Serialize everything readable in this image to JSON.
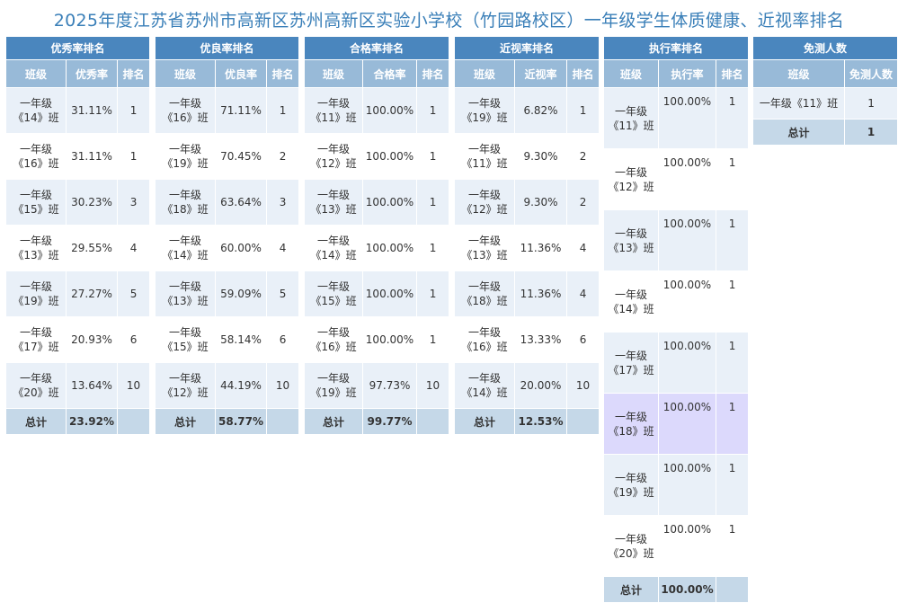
{
  "title": "2025年度江苏省苏州市高新区苏州高新区实验小学校（竹园路校区）一年级学生体质健康、近视率排名",
  "excellent": {
    "caption": "优秀率排名",
    "headers": [
      "班级",
      "优秀率",
      "排名"
    ],
    "rows": [
      {
        "cls": "一年级《14》班",
        "val": "31.11%",
        "rank": "1"
      },
      {
        "cls": "一年级《16》班",
        "val": "31.11%",
        "rank": "1"
      },
      {
        "cls": "一年级《15》班",
        "val": "30.23%",
        "rank": "3"
      },
      {
        "cls": "一年级《13》班",
        "val": "29.55%",
        "rank": "4"
      },
      {
        "cls": "一年级《19》班",
        "val": "27.27%",
        "rank": "5"
      },
      {
        "cls": "一年级《17》班",
        "val": "20.93%",
        "rank": "6"
      },
      {
        "cls": "一年级《20》班",
        "val": "13.64%",
        "rank": "10"
      }
    ],
    "total_label": "总计",
    "total_val": "23.92%"
  },
  "good": {
    "caption": "优良率排名",
    "headers": [
      "班级",
      "优良率",
      "排名"
    ],
    "rows": [
      {
        "cls": "一年级《16》班",
        "val": "71.11%",
        "rank": "1"
      },
      {
        "cls": "一年级《19》班",
        "val": "70.45%",
        "rank": "2"
      },
      {
        "cls": "一年级《18》班",
        "val": "63.64%",
        "rank": "3"
      },
      {
        "cls": "一年级《14》班",
        "val": "60.00%",
        "rank": "4"
      },
      {
        "cls": "一年级《13》班",
        "val": "59.09%",
        "rank": "5"
      },
      {
        "cls": "一年级《15》班",
        "val": "58.14%",
        "rank": "6"
      },
      {
        "cls": "一年级《12》班",
        "val": "44.19%",
        "rank": "10"
      }
    ],
    "total_label": "总计",
    "total_val": "58.77%"
  },
  "pass": {
    "caption": "合格率排名",
    "headers": [
      "班级",
      "合格率",
      "排名"
    ],
    "rows": [
      {
        "cls": "一年级《11》班",
        "val": "100.00%",
        "rank": "1"
      },
      {
        "cls": "一年级《12》班",
        "val": "100.00%",
        "rank": "1"
      },
      {
        "cls": "一年级《13》班",
        "val": "100.00%",
        "rank": "1"
      },
      {
        "cls": "一年级《14》班",
        "val": "100.00%",
        "rank": "1"
      },
      {
        "cls": "一年级《15》班",
        "val": "100.00%",
        "rank": "1"
      },
      {
        "cls": "一年级《16》班",
        "val": "100.00%",
        "rank": "1"
      },
      {
        "cls": "一年级《19》班",
        "val": "97.73%",
        "rank": "10"
      }
    ],
    "total_label": "总计",
    "total_val": "99.77%"
  },
  "myopia": {
    "caption": "近视率排名",
    "headers": [
      "班级",
      "近视率",
      "排名"
    ],
    "rows": [
      {
        "cls": "一年级《19》班",
        "val": "6.82%",
        "rank": "1"
      },
      {
        "cls": "一年级《11》班",
        "val": "9.30%",
        "rank": "2"
      },
      {
        "cls": "一年级《12》班",
        "val": "9.30%",
        "rank": "2"
      },
      {
        "cls": "一年级《13》班",
        "val": "11.36%",
        "rank": "4"
      },
      {
        "cls": "一年级《18》班",
        "val": "11.36%",
        "rank": "4"
      },
      {
        "cls": "一年级《16》班",
        "val": "13.33%",
        "rank": "6"
      },
      {
        "cls": "一年级《14》班",
        "val": "20.00%",
        "rank": "10"
      }
    ],
    "total_label": "总计",
    "total_val": "12.53%"
  },
  "execution": {
    "caption": "执行率排名",
    "headers": [
      "班级",
      "执行率",
      "排名"
    ],
    "rows": [
      {
        "cls": "一年级《11》班",
        "val": "100.00%",
        "rank": "1"
      },
      {
        "cls": "一年级《12》班",
        "val": "100.00%",
        "rank": "1"
      },
      {
        "cls": "一年级《13》班",
        "val": "100.00%",
        "rank": "1"
      },
      {
        "cls": "一年级《14》班",
        "val": "100.00%",
        "rank": "1"
      },
      {
        "cls": "一年级《17》班",
        "val": "100.00%",
        "rank": "1"
      },
      {
        "cls": "一年级《18》班",
        "val": "100.00%",
        "rank": "1"
      },
      {
        "cls": "一年级《19》班",
        "val": "100.00%",
        "rank": "1"
      },
      {
        "cls": "一年级《20》班",
        "val": "100.00%",
        "rank": "1"
      }
    ],
    "total_label": "总计",
    "total_val": "100.00%"
  },
  "exempt": {
    "caption": "免测人数",
    "headers": [
      "班级",
      "免测人数"
    ],
    "rows": [
      {
        "cls": "一年级《11》班",
        "val": "1"
      }
    ],
    "total_label": "总计",
    "total_val": "1"
  },
  "colors": {
    "title": "#3a7fb8",
    "caption_bg": "#4a86be",
    "header_bg": "#98bad8",
    "row_alt_bg": "#e9f0f8",
    "highlight_bg": "#dcd9fc",
    "total_bg": "#c5d8e8"
  }
}
